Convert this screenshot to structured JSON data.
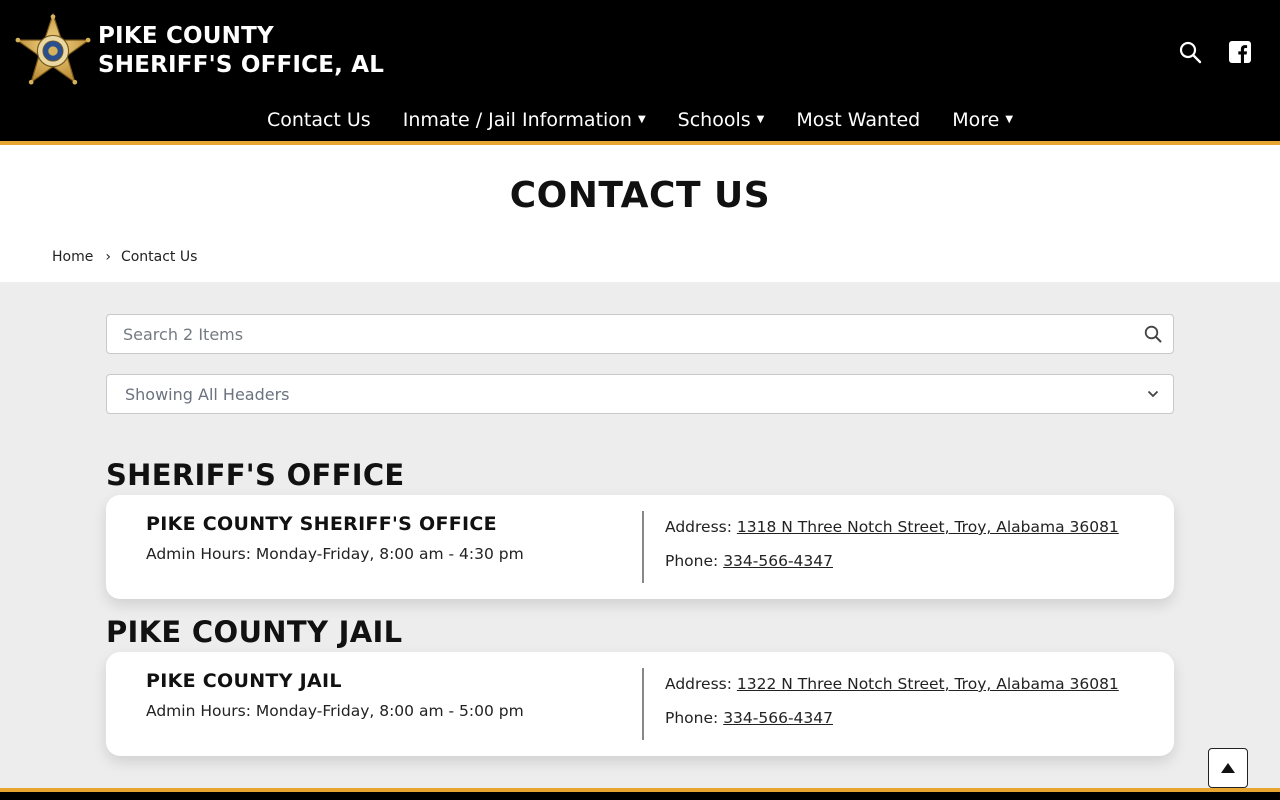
{
  "site": {
    "title_line1": "PIKE COUNTY",
    "title_line2": "SHERIFF'S OFFICE, AL",
    "logo_icon": "sheriff-star-badge-icon",
    "accent_color": "#e8a530"
  },
  "header_icons": [
    "search-icon",
    "facebook-icon"
  ],
  "nav": [
    {
      "label": "Contact Us",
      "has_dropdown": false
    },
    {
      "label": "Inmate / Jail Information",
      "has_dropdown": true
    },
    {
      "label": "Schools",
      "has_dropdown": true
    },
    {
      "label": "Most Wanted",
      "has_dropdown": false
    },
    {
      "label": "More",
      "has_dropdown": true
    }
  ],
  "page": {
    "title": "CONTACT US",
    "breadcrumb": {
      "home": "Home",
      "separator": "›",
      "current": "Contact Us"
    }
  },
  "search": {
    "placeholder": "Search 2 Items",
    "value": ""
  },
  "filter": {
    "selected": "Showing All Headers"
  },
  "sections": [
    {
      "heading": "SHERIFF'S OFFICE",
      "card": {
        "name": "PIKE COUNTY SHERIFF'S OFFICE",
        "hours": "Admin Hours: Monday-Friday, 8:00 am - 4:30 pm",
        "address_label": "Address:",
        "address": "1318 N Three Notch Street, Troy, Alabama 36081",
        "phone_label": "Phone:",
        "phone": "334-566-4347"
      }
    },
    {
      "heading": "PIKE COUNTY JAIL",
      "card": {
        "name": "PIKE COUNTY JAIL",
        "hours": "Admin Hours: Monday-Friday, 8:00 am - 5:00 pm",
        "address_label": "Address:",
        "address": "1322 N Three Notch Street, Troy, Alabama 36081",
        "phone_label": "Phone:",
        "phone": "334-566-4347"
      }
    }
  ]
}
